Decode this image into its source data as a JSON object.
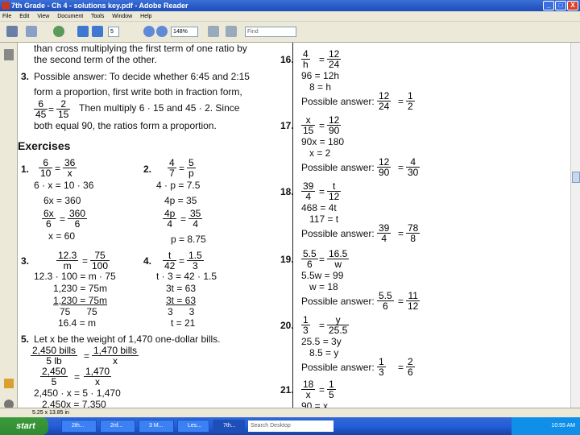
{
  "window": {
    "title": "7th Grade - Ch 4 - solutions key.pdf - Adobe Reader",
    "min": "_",
    "max": "□",
    "close": "X"
  },
  "menu": [
    "File",
    "Edit",
    "View",
    "Document",
    "Tools",
    "Window",
    "Help"
  ],
  "toolbar": {
    "page": "5",
    "zoom": "148%",
    "find": "Find"
  },
  "status": "5.25 x 13.85 in",
  "left": {
    "top1": "than cross multiplying the first term of one ratio by",
    "top2": "the second term of the other.",
    "p3n": "3.",
    "p3a": "Possible answer: To decide whether 6:45 and 2:15",
    "p3b": "form a proportion, first write both in fraction form,",
    "p3c": "Then multiply 6 · 15 and 45 · 2. Since",
    "p3d": "both equal 90, the ratios form a proportion.",
    "fa": {
      "n": "6",
      "d": "45"
    },
    "fb": {
      "n": "2",
      "d": "15"
    },
    "eqq": "=",
    "heading": "Exercises",
    "e1n": "1.",
    "e1": {
      "an": "6",
      "ad": "10",
      "bn": "36",
      "bd": "x"
    },
    "e1l": [
      "6 · x = 10 · 36",
      "6x = 360"
    ],
    "e1f": {
      "an": "6x",
      "ad": "6",
      "bn": "360",
      "bd": "6"
    },
    "e1r": "x = 60",
    "e2n": "2.",
    "e2": {
      "an": "4",
      "ad": "7",
      "bn": "5",
      "bd": "p"
    },
    "e2l": [
      "4 · p = 7.5",
      "4p = 35"
    ],
    "e2f": {
      "an": "4p",
      "ad": "4",
      "bn": "35",
      "bd": "4"
    },
    "e2r": "p = 8.75",
    "e3n": "3.",
    "e3": {
      "an": "12.3",
      "ad": "m",
      "bn": "75",
      "bd": "100"
    },
    "e3l": [
      "12.3 · 100 = m · 75",
      "1,230 = 75m",
      "1,230 = 75m",
      "75      75",
      "16.4 = m"
    ],
    "e4n": "4.",
    "e4": {
      "an": "t",
      "ad": "42",
      "bn": "1.5",
      "bd": "3"
    },
    "e4l": [
      "t · 3 = 42 · 1.5",
      "3t = 63",
      "3t = 63",
      "3      3",
      "t = 21"
    ],
    "e5n": "5.",
    "e5": "Let x be the weight of 1,470 one-dollar bills.",
    "e5f1": {
      "an": "2,450 bills",
      "ad": "5 lb",
      "bn": "1,470 bills",
      "bd": "x"
    },
    "e5f2": {
      "an": "2,450",
      "ad": "5",
      "bn": "1,470",
      "bd": "x"
    },
    "e5l": [
      "2,450 · x = 5 · 1,470",
      "2,450x = 7,350"
    ]
  },
  "right": {
    "p16": {
      "num": "16.",
      "f": {
        "an": "4",
        "ad": "h",
        "bn": "12",
        "bd": "24"
      },
      "l1": "96 = 12h",
      "l2": "8 = h",
      "pa": "Possible answer:",
      "g": {
        "an": "12",
        "ad": "24",
        "bn": "1",
        "bd": "2"
      }
    },
    "p17": {
      "num": "17.",
      "f": {
        "an": "x",
        "ad": "15",
        "bn": "12",
        "bd": "90"
      },
      "l1": "90x = 180",
      "l2": "x = 2",
      "pa": "Possible answer:",
      "g": {
        "an": "12",
        "ad": "90",
        "bn": "4",
        "bd": "30"
      }
    },
    "p18": {
      "num": "18.",
      "f": {
        "an": "39",
        "ad": "4",
        "bn": "t",
        "bd": "12"
      },
      "l1": "468 = 4t",
      "l2": "117 = t",
      "pa": "Possible answer:",
      "g": {
        "an": "39",
        "ad": "4",
        "bn": "78",
        "bd": "8"
      }
    },
    "p19": {
      "num": "19.",
      "f": {
        "an": "5.5",
        "ad": "6",
        "bn": "16.5",
        "bd": "w"
      },
      "l1": "5.5w = 99",
      "l2": "w = 18",
      "pa": "Possible answer:",
      "g": {
        "an": "5.5",
        "ad": "6",
        "bn": "11",
        "bd": "12"
      }
    },
    "p20": {
      "num": "20.",
      "f": {
        "an": "1",
        "ad": "3",
        "bn": "y",
        "bd": "25.5"
      },
      "l1": "25.5 = 3y",
      "l2": "8.5 = y",
      "pa": "Possible answer:",
      "g": {
        "an": "1",
        "ad": "3",
        "bn": "2",
        "bd": "6"
      }
    },
    "p21": {
      "num": "21.",
      "f": {
        "an": "18",
        "ad": "x",
        "bn": "1",
        "bd": "5"
      },
      "l1": "90 = x"
    }
  },
  "taskbar": {
    "start": "start",
    "tasks": [
      "2th...",
      "2nf...",
      "3 M...",
      "Les...",
      "7th..."
    ],
    "search": "Search Desktop",
    "clock": "10:55 AM"
  }
}
